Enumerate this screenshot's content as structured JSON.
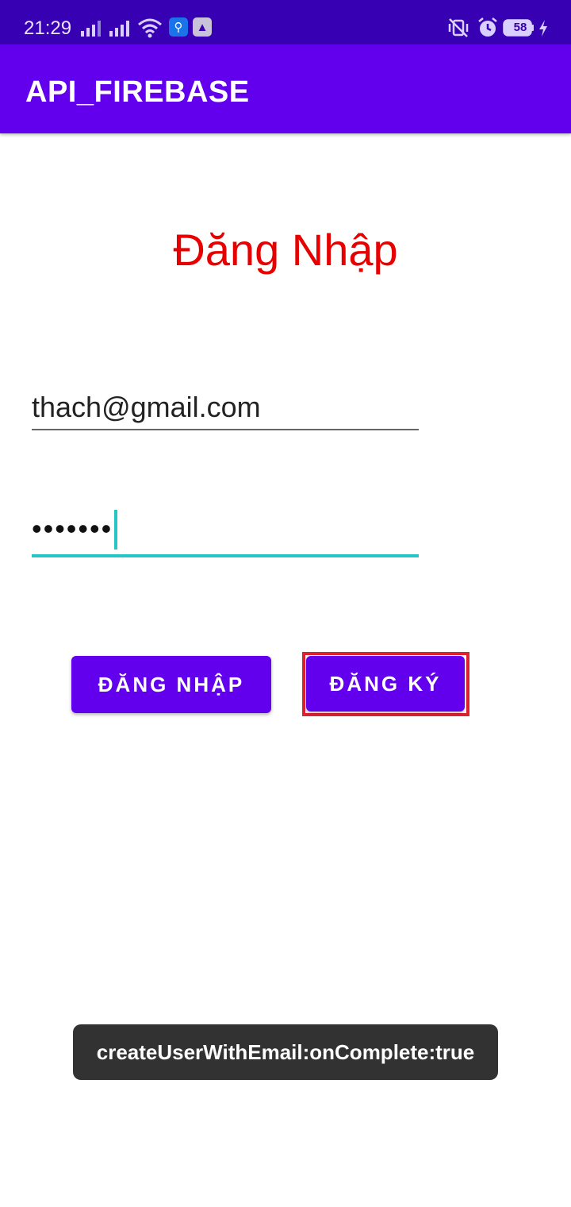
{
  "status_bar": {
    "time": "21:29",
    "battery": "58",
    "icons": [
      "signal-icon",
      "signal-icon",
      "wifi-icon",
      "usb-icon",
      "app-icon",
      "vibrate-off-icon",
      "alarm-icon",
      "battery-icon",
      "charging-icon"
    ]
  },
  "app_bar": {
    "title": "API_FIREBASE"
  },
  "screen": {
    "title": "Đăng Nhập",
    "email": {
      "value": "thach@gmail.com"
    },
    "password": {
      "value": "•••••••"
    },
    "buttons": {
      "login": "ĐĂNG NHẬP",
      "register": "ĐĂNG KÝ"
    }
  },
  "toast": {
    "message": "createUserWithEmail:onComplete:true"
  },
  "colors": {
    "primary": "#6200ee",
    "primary_dark": "#3700b3",
    "accent": "#26c6c6",
    "title": "#e60000",
    "highlight": "#e0202e"
  }
}
